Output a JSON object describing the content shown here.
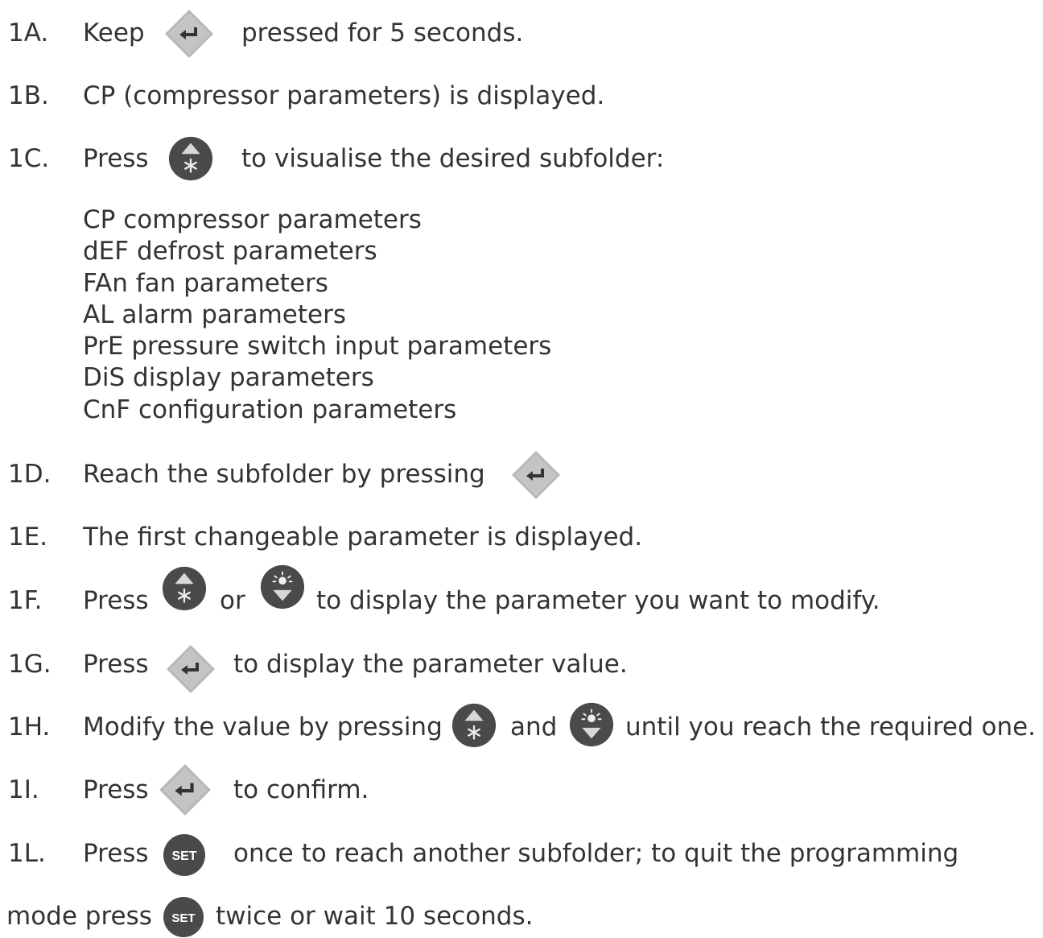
{
  "steps": [
    {
      "num": "1A.",
      "parts": [
        "Keep",
        "pressed for 5 seconds."
      ]
    },
    {
      "num": "1B.",
      "parts": [
        "CP (compressor parameters) is displayed."
      ]
    },
    {
      "num": "1C.",
      "parts": [
        "Press",
        "to visualise the desired subfolder:"
      ]
    },
    {
      "num": "1D.",
      "parts": [
        "Reach the subfolder by pressing"
      ]
    },
    {
      "num": "1E.",
      "parts": [
        "The first changeable parameter  is displayed."
      ]
    },
    {
      "num": "1F.",
      "parts": [
        "Press",
        "or",
        "to display the parameter you want to modify."
      ]
    },
    {
      "num": "1G.",
      "parts": [
        "Press",
        "to display the parameter value."
      ]
    },
    {
      "num": "1H.",
      "parts": [
        "Modify the value by pressing",
        "and",
        "until you reach the required one."
      ]
    },
    {
      "num": "1I.",
      "parts": [
        "Press",
        "to confirm."
      ]
    },
    {
      "num": "1L.",
      "parts": [
        "Press",
        "once to reach another subfolder;  to quit the programming"
      ]
    }
  ],
  "final_line": [
    "mode press",
    "twice or wait 10 seconds."
  ],
  "subfolders": [
    "CP   compressor parameters",
    "dEF defrost parameters",
    "FAn fan parameters",
    "AL alarm parameters",
    "PrE pressure switch input parameters",
    "DiS display parameters",
    "CnF configuration parameters"
  ],
  "icons": {
    "set_label": "SET",
    "enter": "enter-key-icon",
    "up": "up-arrow-snowflake-icon",
    "down": "down-arrow-light-icon",
    "set": "set-key-icon"
  },
  "colors": {
    "text": "#333333",
    "enter_key": "#b8b8b8",
    "round_key": "#4a4a4a"
  }
}
